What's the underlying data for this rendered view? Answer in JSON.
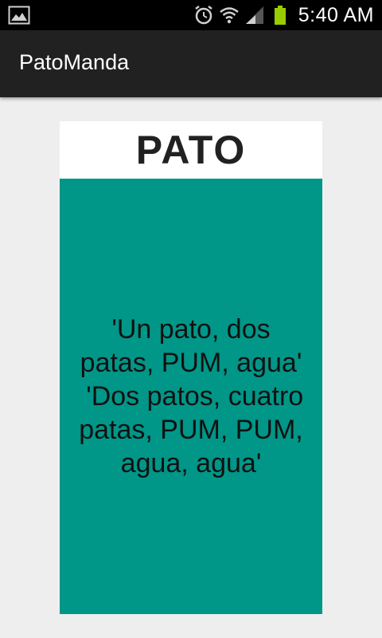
{
  "status_bar": {
    "time": "5:40 AM",
    "icons": [
      "gallery-icon",
      "alarm-icon",
      "wifi-icon",
      "signal-icon",
      "battery-icon"
    ],
    "battery_color": "#99cc00"
  },
  "action_bar": {
    "title": "PatoManda"
  },
  "card": {
    "title": "PATO",
    "lines": [
      "'Un pato, dos",
      "patas, PUM, agua'",
      " 'Dos patos, cuatro",
      "patas, PUM, PUM,",
      "agua, agua'"
    ],
    "body_color": "#009688"
  }
}
